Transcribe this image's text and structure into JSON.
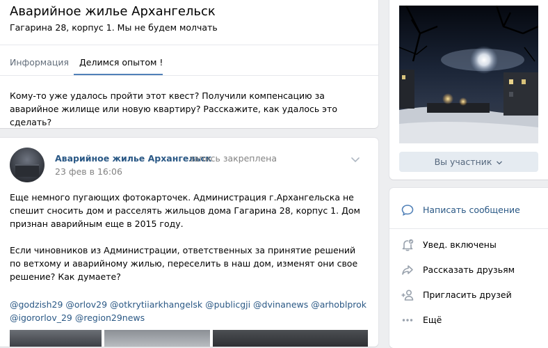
{
  "header": {
    "title": "Аварийное жилье Архангельск",
    "status": "Гагарина 28, корпус 1. Мы не будем молчать"
  },
  "tabs": [
    {
      "label": "Информация"
    },
    {
      "label": "Делимся опытом !"
    }
  ],
  "tab_content": "Кому-то уже удалось пройти этот квест? Получили компенсацию за аварийное жилище или новую квартиру? Расскажите, как удалось это сделать?",
  "post": {
    "author": "Аварийное жилье Архангельск",
    "pinned": "запись закреплена",
    "date": "23 фев в 16:06",
    "paragraphs": [
      "Еще немного пугающих фотокарточек. Администрация г.Архангельска не спешит сносить дом и расселять жильцов дома Гагарина 28, корпус 1. Дом признан аварийным еще в 2015 году.",
      "Если чиновников из Администрации, ответственных за принятие решений по ветхому и аварийному жилью, переселить в наш дом, изменят они свое решение? Как думаете?"
    ],
    "tags": "@godzish29 @orlov29 @otkrytiiarkhangelsk @publicgji @dvinanews @arhoblprok @igororlov_29 @region29news"
  },
  "sidebar": {
    "member_button": "Вы участник",
    "actions": [
      {
        "label": "Написать сообщение",
        "icon": "message-icon"
      },
      {
        "label": "Увед. включены",
        "icon": "bell-icon"
      },
      {
        "label": "Рассказать друзьям",
        "icon": "share-icon"
      },
      {
        "label": "Пригласить друзей",
        "icon": "add-user-icon"
      },
      {
        "label": "Ещё",
        "icon": "more-icon"
      }
    ]
  },
  "colors": {
    "link": "#2a5885",
    "accent": "#5181b8",
    "muted": "#828282",
    "icon": "#99a2ad",
    "button_bg": "#e5ebf1"
  }
}
